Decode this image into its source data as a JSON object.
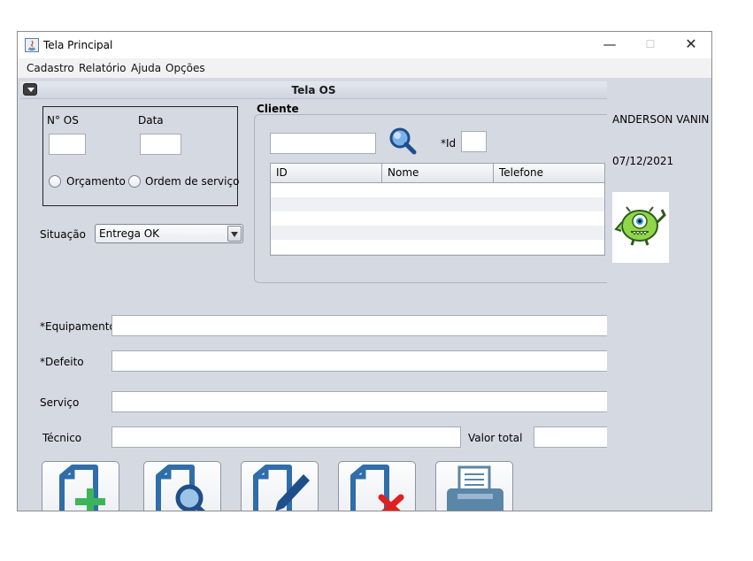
{
  "window": {
    "title": "Tela Principal"
  },
  "menu": [
    "Cadastro",
    "Relatório",
    "Ajuda",
    "Opções"
  ],
  "internal_frame": {
    "title": "Tela OS"
  },
  "os_panel": {
    "os_number_label": "N° OS",
    "date_label": "Data",
    "os_number_value": "",
    "date_value": "",
    "radio_budget_label": "Orçamento",
    "radio_service_order_label": "Ordem de serviço"
  },
  "status": {
    "label": "Situação",
    "selected": "Entrega OK"
  },
  "client": {
    "title": "Cliente",
    "search_value": "",
    "id_label": "*Id",
    "id_value": "",
    "columns": [
      "ID",
      "Nome",
      "Telefone"
    ],
    "rows": []
  },
  "form": {
    "equipment_label": "*Equipamento",
    "defect_label": "*Defeito",
    "service_label": "Serviço",
    "technician_label": "Técnico",
    "total_label": "Valor total",
    "equipment_value": "",
    "defect_value": "",
    "service_value": "",
    "technician_value": "",
    "total_value": ""
  },
  "user": {
    "name": "ANDERSON VANIN",
    "date": "07/12/2021"
  },
  "colors": {
    "icon_blue": "#2f6ea8",
    "add_green": "#3cb55a",
    "delete_red": "#e02020",
    "printer": "#5a86a8",
    "background": "#d5d9e2"
  },
  "icons": [
    "add-document-icon",
    "search-document-icon",
    "edit-document-icon",
    "delete-document-icon",
    "printer-icon"
  ]
}
